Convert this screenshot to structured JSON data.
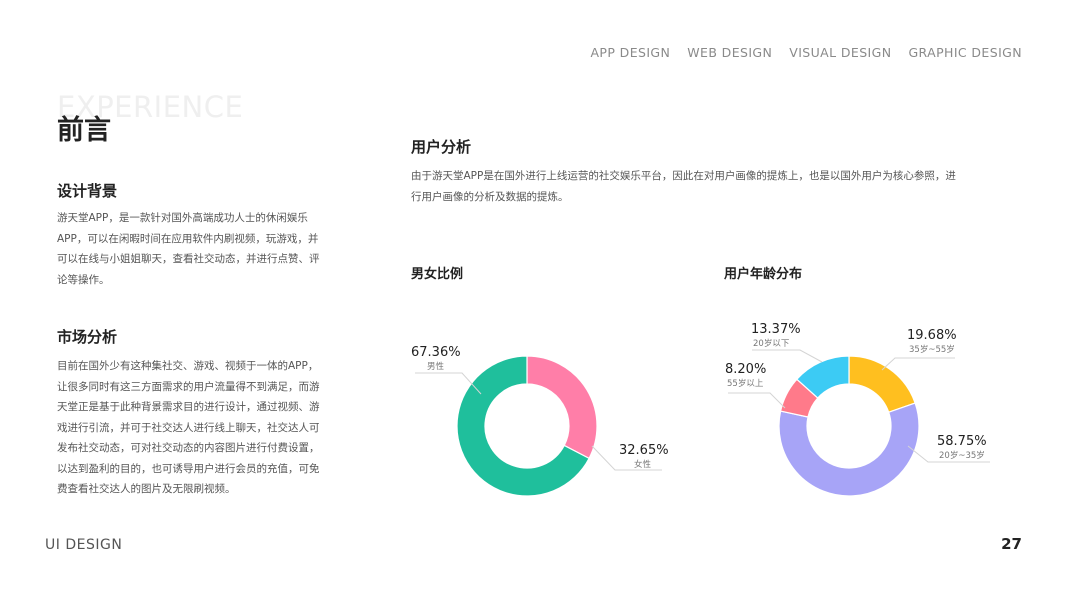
{
  "nav": [
    "APP DESIGN",
    "WEB DESIGN",
    "VISUAL DESIGN",
    "GRAPHIC DESIGN"
  ],
  "watermark": "EXPERIENCE",
  "page_title": "前言",
  "left": {
    "design_bg_title": "设计背景",
    "design_bg_lines": [
      "游天堂APP，是一款针对国外高端成功人士的休闲娱乐",
      "APP，可以在闲暇时间在应用软件内刷视频，玩游戏，并",
      "可以在线与小姐姐聊天，查看社交动态，并进行点赞、评",
      "论等操作。"
    ],
    "market_title": "市场分析",
    "market_lines": [
      "目前在国外少有这种集社交、游戏、视频于一体的APP，",
      "让很多同时有这三方面需求的用户流量得不到满足，而游",
      "天堂正是基于此种背景需求目的进行设计，通过视频、游",
      "戏进行引流，并可于社交达人进行线上聊天，社交达人可",
      "发布社交动态，可对社交动态的内容图片进行付费设置，",
      "以达到盈利的目的，也可诱导用户进行会员的充值，可免",
      "费查看社交达人的图片及无限刷视频。"
    ]
  },
  "user": {
    "title": "用户分析",
    "lines": [
      "由于游天堂APP是在国外进行上线运营的社交娱乐平台，因此在对用户画像的提炼上，也是以国外用户为核心参照，进",
      "行用户画像的分析及数据的提炼。"
    ]
  },
  "footer": {
    "left": "UI DESIGN",
    "page_number": "27"
  },
  "chart_data": [
    {
      "type": "pie",
      "title": "男女比例",
      "categories": [
        "女性",
        "男性"
      ],
      "values": [
        32.65,
        67.36
      ],
      "labels": [
        "32.65%",
        "67.36%"
      ],
      "colors": [
        "#FF7EA8",
        "#1FBF9C"
      ]
    },
    {
      "type": "pie",
      "title": "用户年龄分布",
      "categories": [
        "35岁~55岁",
        "20岁~35岁",
        "55岁以上",
        "20岁以下"
      ],
      "values": [
        19.68,
        58.75,
        8.2,
        13.37
      ],
      "labels": [
        "19.68%",
        "58.75%",
        "8.20%",
        "13.37%"
      ],
      "colors": [
        "#FFBF1F",
        "#A7A4F7",
        "#FF7A8A",
        "#3CCBF4"
      ]
    }
  ]
}
